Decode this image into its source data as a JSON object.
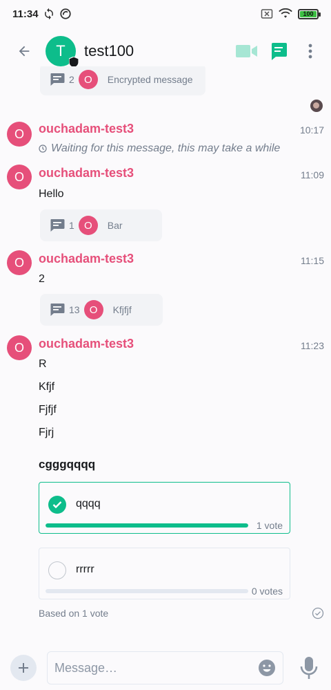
{
  "status_bar": {
    "time": "11:34",
    "battery": "100"
  },
  "header": {
    "room_avatar_letter": "T",
    "room_name": "test100"
  },
  "timeline": {
    "top_thread": {
      "count": "2",
      "avatar_letter": "O",
      "preview": "Encrypted message"
    },
    "messages": [
      {
        "avatar_letter": "O",
        "sender": "ouchadam-test3",
        "time": "10:17",
        "waiting_text": "Waiting for this message, this may take a while"
      },
      {
        "avatar_letter": "O",
        "sender": "ouchadam-test3",
        "time": "11:09",
        "body": "Hello",
        "thread": {
          "count": "1",
          "avatar_letter": "O",
          "preview": "Bar"
        }
      },
      {
        "avatar_letter": "O",
        "sender": "ouchadam-test3",
        "time": "11:15",
        "body": "2",
        "thread": {
          "count": "13",
          "avatar_letter": "O",
          "preview": "Kfjfjf"
        }
      },
      {
        "avatar_letter": "O",
        "sender": "ouchadam-test3",
        "time": "11:23",
        "lines": [
          "R",
          "Kfjf",
          "Fjfjf",
          "Fjrj"
        ]
      }
    ],
    "poll": {
      "question": "cgggqqqq",
      "options": [
        {
          "label": "qqqq",
          "votes": "1 vote",
          "fraction": 1.0,
          "selected": true
        },
        {
          "label": "rrrrr",
          "votes": "0 votes",
          "fraction": 0.0,
          "selected": false
        }
      ],
      "footer": "Based on 1 vote"
    }
  },
  "composer": {
    "placeholder": "Message…"
  },
  "colors": {
    "accent": "#0dbd8b",
    "sender": "#e64f7a",
    "muted": "#737d8c"
  }
}
